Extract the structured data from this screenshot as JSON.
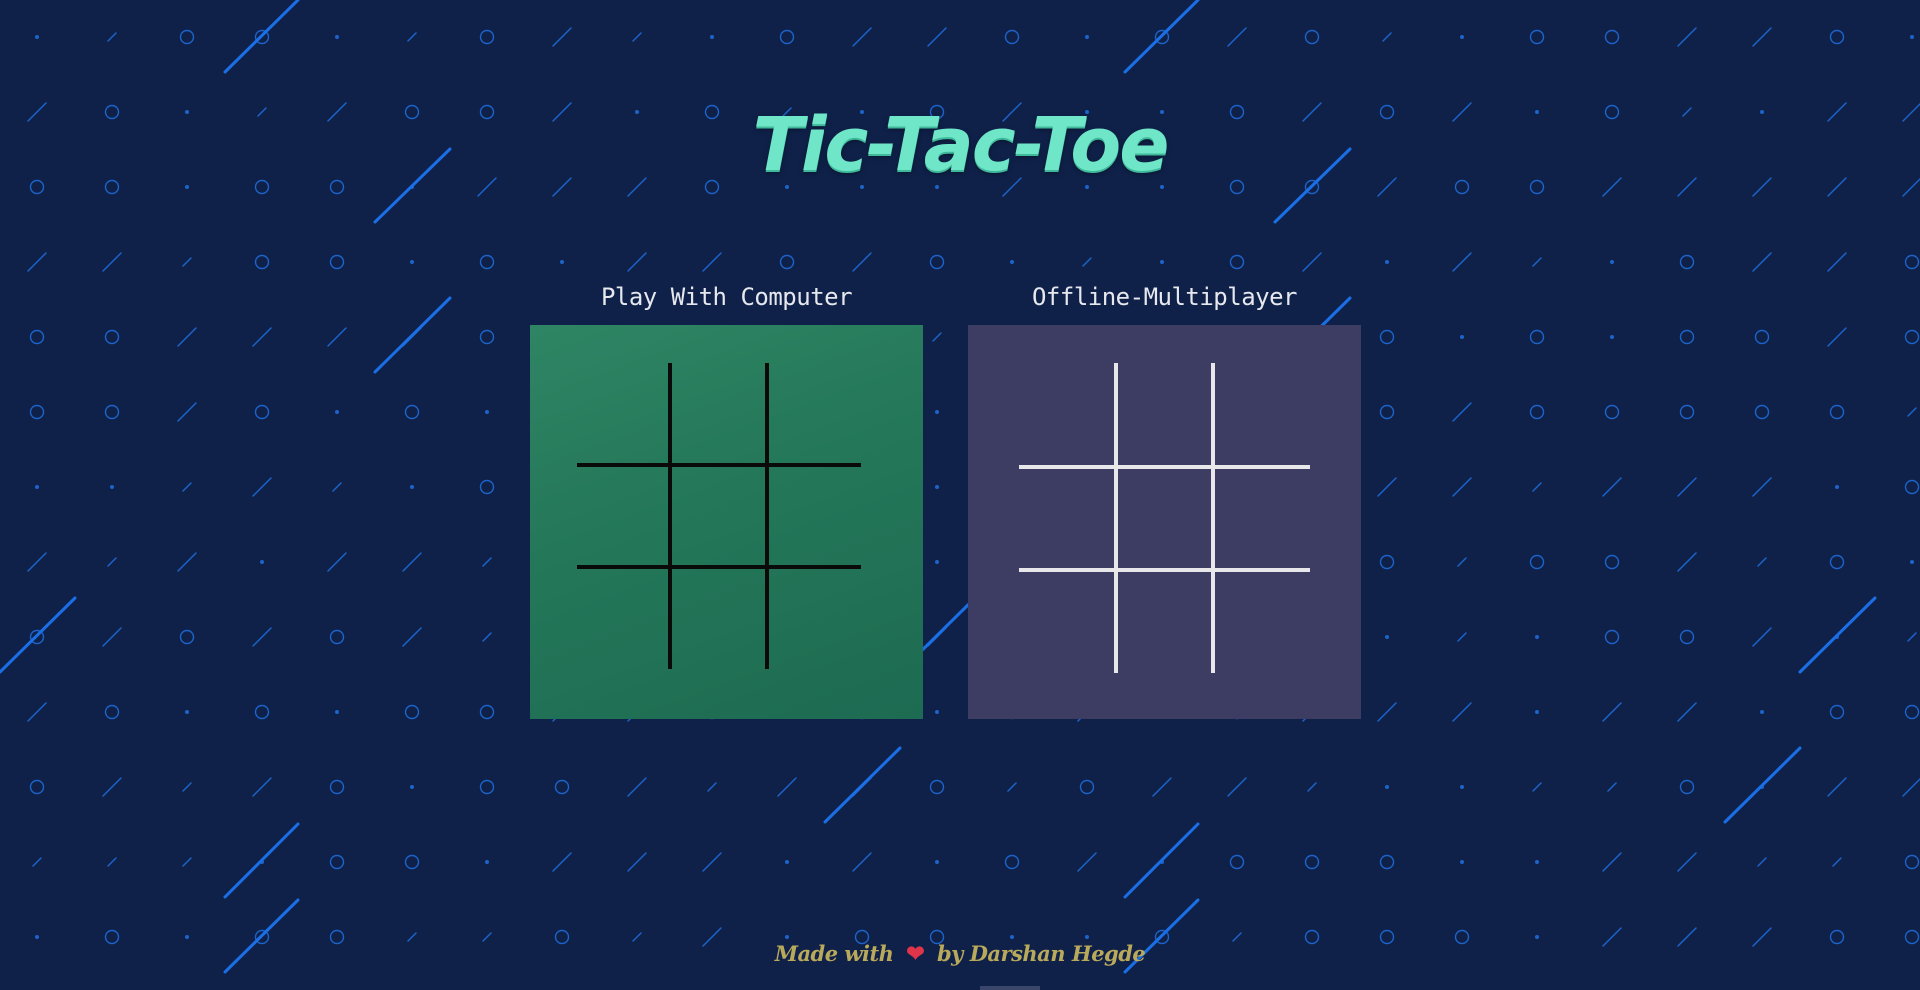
{
  "page": {
    "title": "Tic-Tac-Toe"
  },
  "modes": [
    {
      "label": "Play With Computer",
      "board_color": "#247759",
      "line_color": "#0a0a0a"
    },
    {
      "label": "Offline-Multiplayer",
      "board_color": "#3d3d63",
      "line_color": "#e8e8ea"
    }
  ],
  "footer": {
    "prefix": "Made with",
    "heart_icon": "heart-icon",
    "suffix": "by Darshan Hegde"
  },
  "colors": {
    "background": "#0f2149",
    "pattern": "#1f6fe0",
    "title": "#6ee6c7",
    "footer_text": "#b9a95a"
  }
}
